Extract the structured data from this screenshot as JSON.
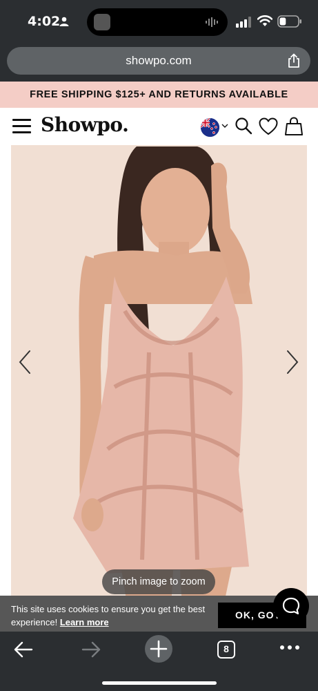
{
  "status_bar": {
    "time": "4:02",
    "battery_level": 0.35
  },
  "browser": {
    "url": "showpo.com",
    "open_tabs": "8"
  },
  "promo": {
    "text": "FREE SHIPPING $125+ AND RETURNS AVAILABLE"
  },
  "header": {
    "logo": "Showpo."
  },
  "gallery": {
    "zoom_hint": "Pinch image to zoom"
  },
  "cookie": {
    "text": "This site uses cookies to ensure you get the best experience!",
    "link": "Learn more",
    "button": "OK, GOT"
  },
  "colors": {
    "promo_bg": "#f4cdc6",
    "browser_chrome": "#2b2e31",
    "photo_bg": "#f1dfd3"
  }
}
